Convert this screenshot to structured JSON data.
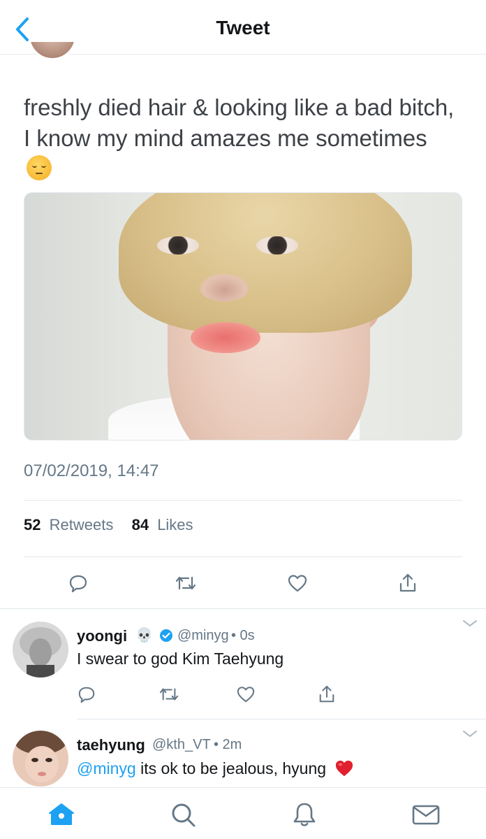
{
  "header": {
    "title": "Tweet",
    "back_icon": "chevron-left-icon"
  },
  "tweet": {
    "text": "freshly died hair & looking like a bad bitch, I know my mind amazes me sometimes",
    "emoji": "pensive-face-emoji",
    "image_alt": "selfie photo",
    "timestamp": "07/02/2019, 14:47",
    "retweets_count": "52",
    "retweets_label": "Retweets",
    "likes_count": "84",
    "likes_label": "Likes"
  },
  "actions": [
    "reply-icon",
    "retweet-icon",
    "like-icon",
    "share-icon"
  ],
  "replies": [
    {
      "name": "yoongi",
      "badge_emoji": "💀",
      "verified": true,
      "handle": "@minyg",
      "time": "• 0s",
      "text_parts": [
        {
          "type": "text",
          "value": "I swear to god Kim Taehyung"
        }
      ]
    },
    {
      "name": "taehyung",
      "verified": false,
      "handle": "@kth_VT",
      "time": "• 2m",
      "text_parts": [
        {
          "type": "mention",
          "value": "@minyg"
        },
        {
          "type": "text",
          "value": " its ok to be jealous, hyung"
        }
      ],
      "end_emoji": "❤️"
    }
  ],
  "tabbar": {
    "items": [
      "home-icon",
      "search-icon",
      "notifications-icon",
      "messages-icon"
    ],
    "active": "home-icon"
  },
  "colors": {
    "accent": "#1da1f2",
    "text": "#14171a",
    "muted": "#657786",
    "divider": "#e1e8ed"
  }
}
